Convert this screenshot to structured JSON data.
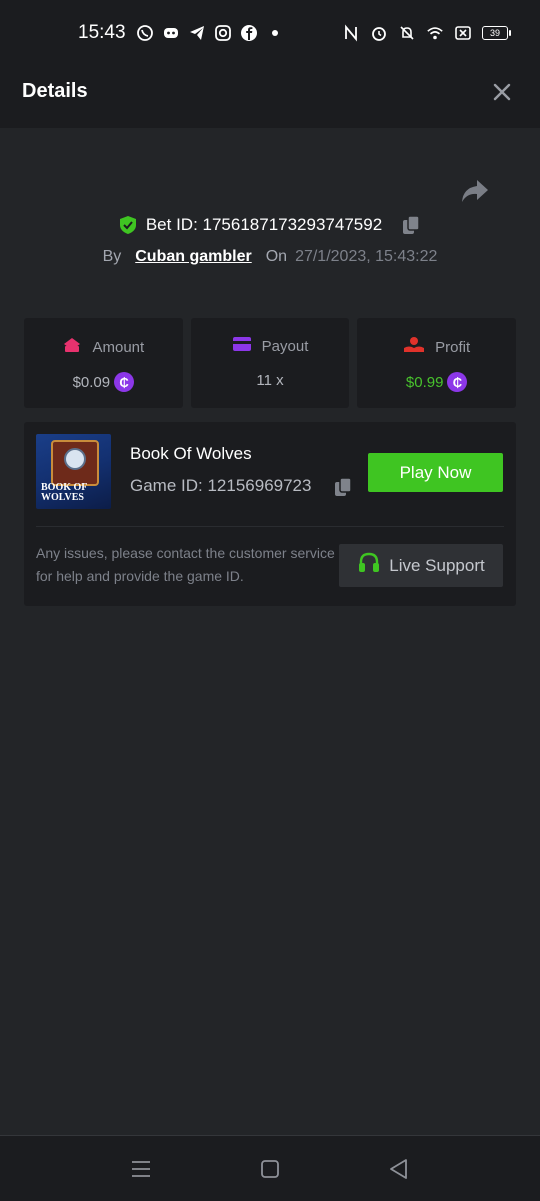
{
  "status_bar": {
    "time": "15:43",
    "battery": "39",
    "left_icons": [
      "whatsapp-icon",
      "discord-icon",
      "telegram-icon",
      "instagram-icon",
      "facebook-icon",
      "dot-icon"
    ],
    "right_icons": [
      "nfc-icon",
      "alarm-icon",
      "mute-icon",
      "wifi-icon",
      "sim-off-icon",
      "battery-icon"
    ]
  },
  "header": {
    "title": "Details"
  },
  "bet": {
    "bet_id_text": "Bet ID: 1756187173293747592",
    "by_label": "By",
    "user": "Cuban gambler",
    "on_label": "On",
    "datetime": "27/1/2023, 15:43:22"
  },
  "stats": {
    "amount": {
      "label": "Amount",
      "value": "$0.09",
      "color": "#e8326e"
    },
    "payout": {
      "label": "Payout",
      "value": "11 x",
      "color": "#8c37e8"
    },
    "profit": {
      "label": "Profit",
      "value": "$0.99",
      "color": "#e0322b",
      "value_color": "#48c32d"
    },
    "coin_symbol": "₵"
  },
  "game": {
    "thumbnail_text": "BOOK OF WOLVES",
    "name": "Book Of Wolves",
    "game_id_text": "Game ID: 12156969723",
    "play_label": "Play Now",
    "issues_text": "Any issues, please contact the customer service for help and provide the game ID.",
    "support_label": "Live Support"
  },
  "colors": {
    "accent_green": "#3fc522",
    "background": "#232528",
    "card": "#1b1c1f"
  }
}
